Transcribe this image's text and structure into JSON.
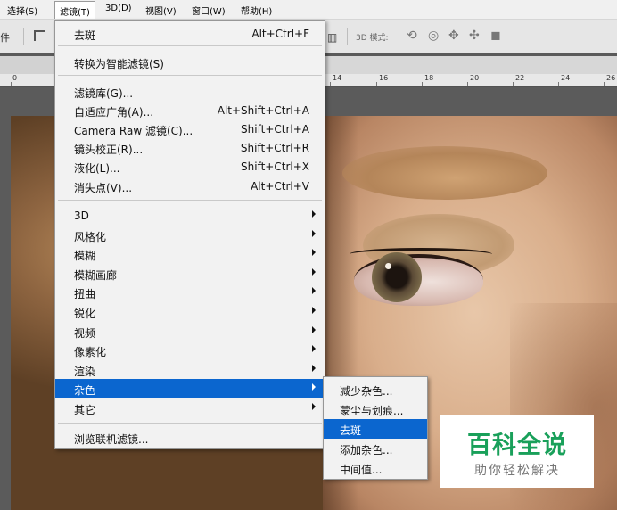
{
  "menubar": {
    "items": [
      {
        "label": "选择(S)"
      },
      {
        "label": "滤镜(T)"
      },
      {
        "label": "3D(D)"
      },
      {
        "label": "视图(V)"
      },
      {
        "label": "窗口(W)"
      },
      {
        "label": "帮助(H)"
      }
    ]
  },
  "options_bar": {
    "file_label": "件",
    "mode_label": "3D 模式:"
  },
  "ruler": {
    "numbers": [
      "0",
      "14",
      "16",
      "18",
      "20",
      "22",
      "24",
      "26"
    ]
  },
  "filter_menu": {
    "last_filter": {
      "label": "去斑",
      "shortcut": "Alt+Ctrl+F"
    },
    "smart": {
      "label": "转换为智能滤镜(S)"
    },
    "group1": [
      {
        "label": "滤镜库(G)...",
        "shortcut": ""
      },
      {
        "label": "自适应广角(A)...",
        "shortcut": "Alt+Shift+Ctrl+A"
      },
      {
        "label": "Camera Raw 滤镜(C)...",
        "shortcut": "Shift+Ctrl+A"
      },
      {
        "label": "镜头校正(R)...",
        "shortcut": "Shift+Ctrl+R"
      },
      {
        "label": "液化(L)...",
        "shortcut": "Shift+Ctrl+X"
      },
      {
        "label": "消失点(V)...",
        "shortcut": "Alt+Ctrl+V"
      }
    ],
    "submenus": [
      {
        "label": "3D"
      },
      {
        "label": "风格化"
      },
      {
        "label": "模糊"
      },
      {
        "label": "模糊画廊"
      },
      {
        "label": "扭曲"
      },
      {
        "label": "锐化"
      },
      {
        "label": "视频"
      },
      {
        "label": "像素化"
      },
      {
        "label": "渲染"
      },
      {
        "label": "杂色"
      },
      {
        "label": "其它"
      }
    ],
    "browse": {
      "label": "浏览联机滤镜..."
    }
  },
  "noise_submenu": {
    "items": [
      {
        "label": "减少杂色..."
      },
      {
        "label": "蒙尘与划痕..."
      },
      {
        "label": "去斑"
      },
      {
        "label": "添加杂色..."
      },
      {
        "label": "中间值..."
      }
    ]
  },
  "watermark": {
    "title": "百科全说",
    "subtitle": "助你轻松解决"
  },
  "colors": {
    "highlight": "#0b66cf",
    "watermark_green": "#19a05a"
  }
}
